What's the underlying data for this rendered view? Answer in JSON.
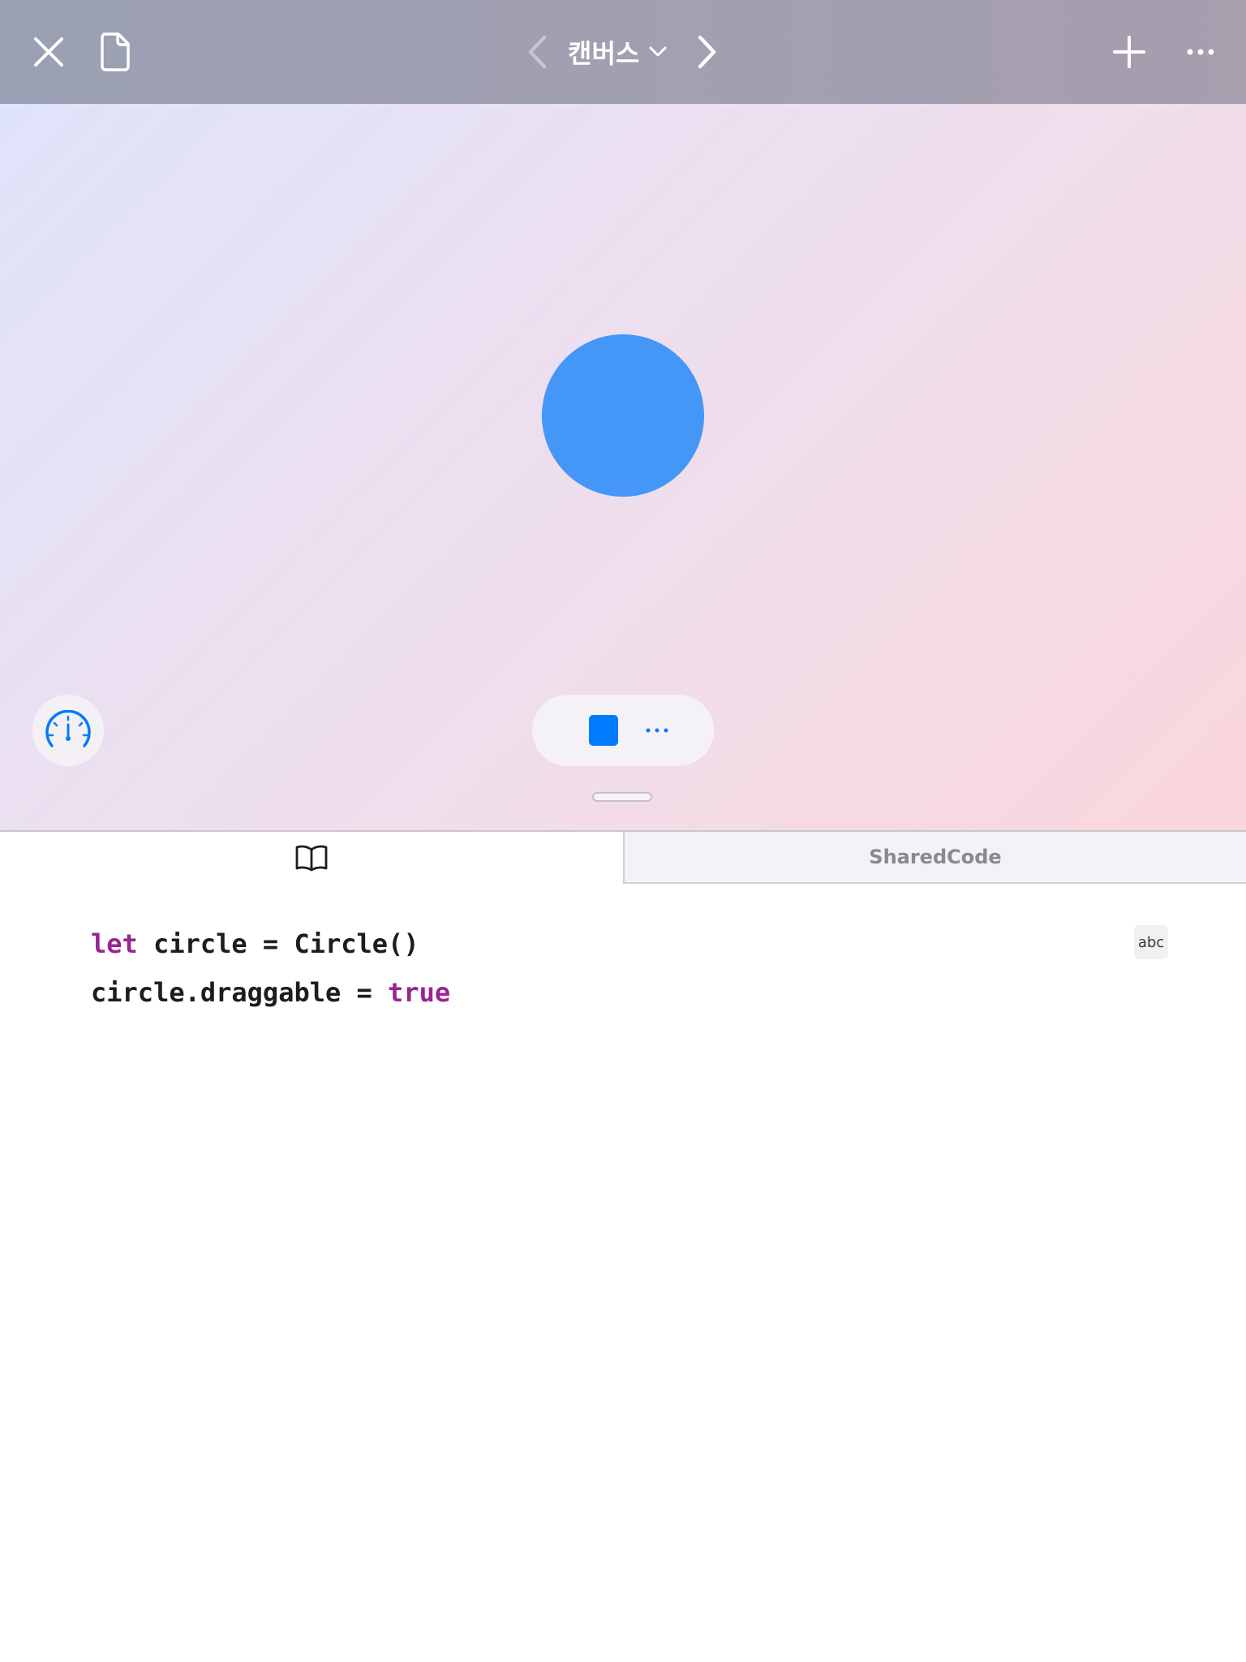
{
  "navbar": {
    "title": "캔버스",
    "icons": {
      "close": "close-icon",
      "document": "document-icon",
      "previous": "chevron-left-icon",
      "next": "chevron-right-icon",
      "title_menu": "chevron-down-icon",
      "add": "plus-icon",
      "more": "ellipsis-icon"
    }
  },
  "liveview": {
    "shape_color": "#4496f7",
    "accent_color": "#007aff",
    "icons": {
      "speed": "speedometer-icon",
      "stop": "stop-icon",
      "run_options": "ellipsis-icon"
    }
  },
  "tabs": {
    "guide_icon": "book-icon",
    "shared_label": "SharedCode"
  },
  "editor": {
    "lines": [
      {
        "keyword": "let",
        "rest": " circle = Circle()"
      },
      {
        "code": "circle.draggable = ",
        "keyword": "true"
      }
    ],
    "abc_label": "abc",
    "keyword_color": "#9b2393"
  }
}
